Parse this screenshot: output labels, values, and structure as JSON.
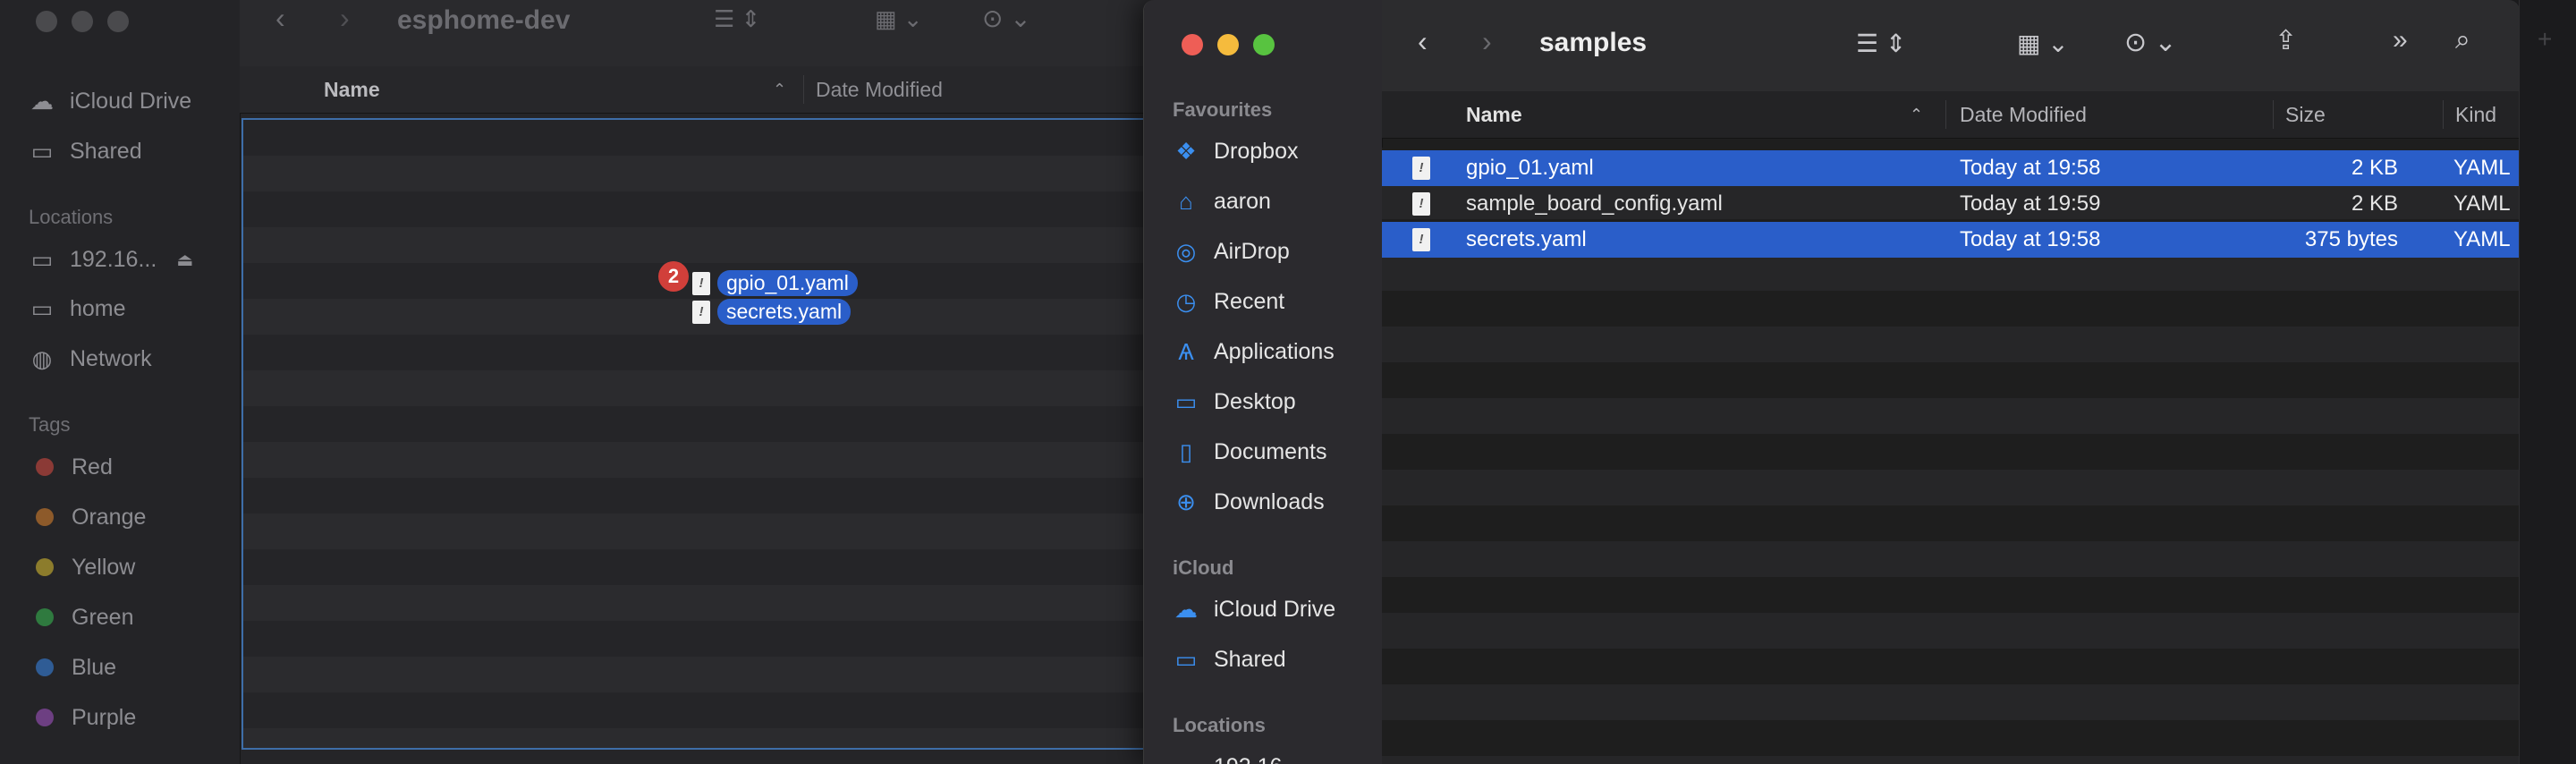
{
  "back_window": {
    "title": "esphome-dev",
    "sidebar": {
      "top_items": [
        {
          "label": "iCloud Drive",
          "icon": "cloud-icon"
        },
        {
          "label": "Shared",
          "icon": "shared-folder-icon"
        }
      ],
      "locations_header": "Locations",
      "locations": [
        {
          "label": "192.16...",
          "icon": "display-icon"
        },
        {
          "label": "home",
          "icon": "display-icon"
        },
        {
          "label": "Network",
          "icon": "globe-icon"
        }
      ],
      "tags_header": "Tags",
      "tags": [
        {
          "label": "Red",
          "color": "#8b3a36"
        },
        {
          "label": "Orange",
          "color": "#8d5a2a"
        },
        {
          "label": "Yellow",
          "color": "#8c7c2c"
        },
        {
          "label": "Green",
          "color": "#2f7a3f"
        },
        {
          "label": "Blue",
          "color": "#2f5c95"
        },
        {
          "label": "Purple",
          "color": "#6d3f82"
        }
      ]
    },
    "columns": {
      "name": "Name",
      "date": "Date Modified"
    },
    "drag": {
      "count": "2",
      "files": [
        "gpio_01.yaml",
        "secrets.yaml"
      ]
    }
  },
  "front_window": {
    "title": "samples",
    "sidebar": {
      "favourites_header": "Favourites",
      "favourites": [
        {
          "label": "Dropbox",
          "icon": "dropbox-icon"
        },
        {
          "label": "aaron",
          "icon": "home-icon"
        },
        {
          "label": "AirDrop",
          "icon": "airdrop-icon"
        },
        {
          "label": "Recent",
          "icon": "clock-icon"
        },
        {
          "label": "Applications",
          "icon": "applications-icon"
        },
        {
          "label": "Desktop",
          "icon": "desktop-icon"
        },
        {
          "label": "Documents",
          "icon": "document-icon"
        },
        {
          "label": "Downloads",
          "icon": "download-icon"
        }
      ],
      "icloud_header": "iCloud",
      "icloud": [
        {
          "label": "iCloud Drive",
          "icon": "cloud-icon"
        },
        {
          "label": "Shared",
          "icon": "shared-folder-icon"
        }
      ],
      "locations_header": "Locations",
      "locations_partial": "192.16..."
    },
    "columns": {
      "name": "Name",
      "date": "Date Modified",
      "size": "Size",
      "kind": "Kind"
    },
    "files": [
      {
        "name": "gpio_01.yaml",
        "date": "Today at 19:58",
        "size": "2 KB",
        "kind": "YAML",
        "selected": true
      },
      {
        "name": "sample_board_config.yaml",
        "date": "Today at 19:59",
        "size": "2 KB",
        "kind": "YAML",
        "selected": false
      },
      {
        "name": "secrets.yaml",
        "date": "Today at 19:58",
        "size": "375 bytes",
        "kind": "YAML",
        "selected": true
      }
    ]
  },
  "colors": {
    "accent": "#2a5ec9",
    "badge": "#d13f3a",
    "close": "#ee5e56",
    "minimize": "#f5bb3d",
    "zoom": "#58c340"
  }
}
